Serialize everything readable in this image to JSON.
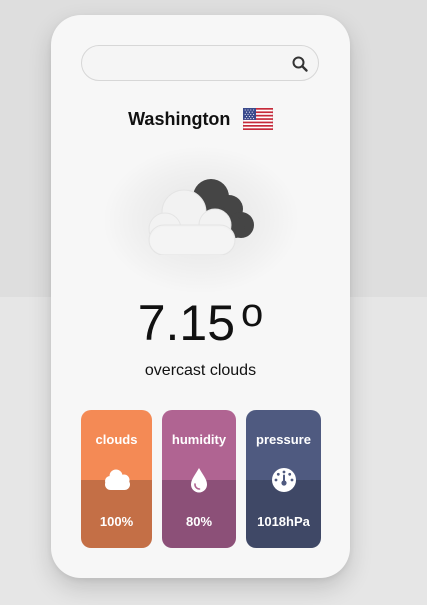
{
  "search": {
    "value": "",
    "icon": "search-icon"
  },
  "location": {
    "city": "Washington",
    "flag_icon": "us-flag-icon"
  },
  "weather": {
    "icon": "overcast-clouds-icon",
    "temperature": "7.15",
    "degree_symbol": "o",
    "description": "overcast clouds"
  },
  "stats": {
    "clouds": {
      "label": "clouds",
      "value": "100%",
      "icon": "cloud-icon",
      "color_top": "#f48a55",
      "color_bottom": "#c46f46"
    },
    "humidity": {
      "label": "humidity",
      "value": "80%",
      "icon": "water-drop-icon",
      "color_top": "#b06492",
      "color_bottom": "#8c5078"
    },
    "pressure": {
      "label": "pressure",
      "value": "1018hPa",
      "icon": "gauge-icon",
      "color_top": "#4f5a80",
      "color_bottom": "#3f4866"
    }
  }
}
